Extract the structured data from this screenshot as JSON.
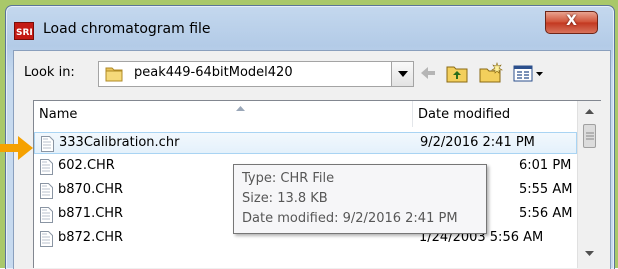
{
  "window": {
    "title": "Load chromatogram file",
    "close_label": "X"
  },
  "look_in": {
    "label": "Look in:",
    "value": "peak449-64bitModel420"
  },
  "toolbar": {
    "icons": [
      "back-arrow-icon",
      "up-folder-icon",
      "new-folder-icon",
      "view-menu-icon"
    ]
  },
  "list": {
    "columns": [
      "Name",
      "Date modified"
    ],
    "rows": [
      {
        "name": "333Calibration.chr",
        "date": "9/2/2016 2:41 PM"
      },
      {
        "name": "602.CHR",
        "date": "6:01 PM"
      },
      {
        "name": "b870.CHR",
        "date": "5:55 AM"
      },
      {
        "name": "b871.CHR",
        "date": "5:56 AM"
      },
      {
        "name": "b872.CHR",
        "date": "1/24/2003 5:56 AM"
      }
    ]
  },
  "tooltip": {
    "type": "Type: CHR File",
    "size": "Size: 13.8 KB",
    "date": "Date modified: 9/2/2016 2:41 PM"
  },
  "colors": {
    "accent": "#f5a100",
    "selection": "#e4f1fb",
    "titlebar": "#b3cbe7"
  }
}
